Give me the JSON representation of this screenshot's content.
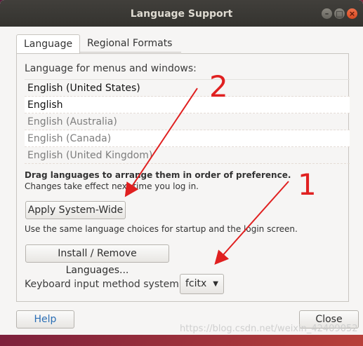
{
  "window": {
    "title": "Language Support",
    "controls": [
      "minimize-icon",
      "maximize-icon",
      "close-icon"
    ]
  },
  "tabs": [
    {
      "label": "Language",
      "active": true
    },
    {
      "label": "Regional Formats",
      "active": false
    }
  ],
  "language_section": {
    "heading": "Language for menus and windows:",
    "languages": [
      {
        "name": "English (United States)",
        "primary": true
      },
      {
        "name": "English",
        "primary": true
      },
      {
        "name": "English (Australia)",
        "primary": false
      },
      {
        "name": "English (Canada)",
        "primary": false
      },
      {
        "name": "English (United Kingdom)",
        "primary": false
      }
    ],
    "hint_bold": "Drag languages to arrange them in order of preference.",
    "hint": "Changes take effect next time you log in."
  },
  "apply_button": "Apply System-Wide",
  "apply_note": "Use the same language choices for startup and the login screen.",
  "install_button": "Install / Remove Languages...",
  "keyboard": {
    "label": "Keyboard input method system:",
    "value": "fcitx"
  },
  "footer": {
    "help_button": "Help",
    "close_button": "Close"
  },
  "annotations": {
    "mark_1": "1",
    "mark_2": "2",
    "color": "#e02020"
  },
  "watermark": "https://blog.csdn.net/weixin_42409052"
}
